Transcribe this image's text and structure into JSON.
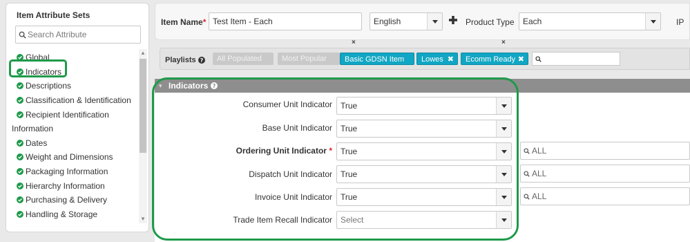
{
  "sidebar": {
    "title": "Item Attribute Sets",
    "search_placeholder": "Search Attribute",
    "items": [
      {
        "label": "Global",
        "check": true
      },
      {
        "label": "Indicators",
        "check": true
      },
      {
        "label": "Descriptions",
        "check": true
      },
      {
        "label": "Classification & Identification",
        "check": true
      },
      {
        "label": "Recipient Identification",
        "check": true
      },
      {
        "label": "Information",
        "check": false
      },
      {
        "label": "Dates",
        "check": true
      },
      {
        "label": "Weight and Dimensions",
        "check": true
      },
      {
        "label": "Packaging Information",
        "check": true
      },
      {
        "label": "Hierarchy Information",
        "check": true
      },
      {
        "label": "Purchasing & Delivery",
        "check": true
      },
      {
        "label": "Handling & Storage",
        "check": true
      }
    ]
  },
  "header": {
    "item_name_label": "Item Name",
    "required_mark": "*",
    "item_name_value": "Test Item - Each",
    "language_value": "English",
    "product_type_label": "Product Type",
    "product_type_value": "Each",
    "ip_label": "IP",
    "clear_mark": "×"
  },
  "playlists": {
    "label": "Playlists",
    "chips": [
      {
        "label": "All Populated",
        "style": "grey",
        "removable": false
      },
      {
        "label": "Most Popular",
        "style": "grey",
        "removable": false
      },
      {
        "label": "Basic GDSN Item",
        "style": "teal",
        "removable": false
      },
      {
        "label": "Lowes",
        "style": "teal",
        "removable": true
      },
      {
        "label": "Ecomm Ready",
        "style": "teal",
        "removable": true
      }
    ],
    "close_glyph": "✖"
  },
  "section": {
    "title": "Indicators",
    "fields": [
      {
        "label": "Consumer Unit Indicator",
        "value": "True",
        "required": false,
        "all": null
      },
      {
        "label": "Base Unit Indicator",
        "value": "True",
        "required": false,
        "all": null
      },
      {
        "label": "Ordering Unit Indicator",
        "value": "True",
        "required": true,
        "all": "ALL"
      },
      {
        "label": "Dispatch Unit Indicator",
        "value": "True",
        "required": false,
        "all": "ALL"
      },
      {
        "label": "Invoice Unit Indicator",
        "value": "True",
        "required": false,
        "all": "ALL"
      },
      {
        "label": "Trade Item Recall Indicator",
        "value": "Select",
        "required": false,
        "all": null
      }
    ]
  },
  "icons": {
    "check": "check-circle-icon",
    "search": "search-icon",
    "help": "help-circle-icon",
    "plus": "plus-icon",
    "caret": "chevron-down-icon"
  },
  "colors": {
    "accent_green": "#1e9a4a",
    "chip_teal": "#11a6c3",
    "section_header": "#8e8e8e",
    "required": "#d9242c"
  }
}
